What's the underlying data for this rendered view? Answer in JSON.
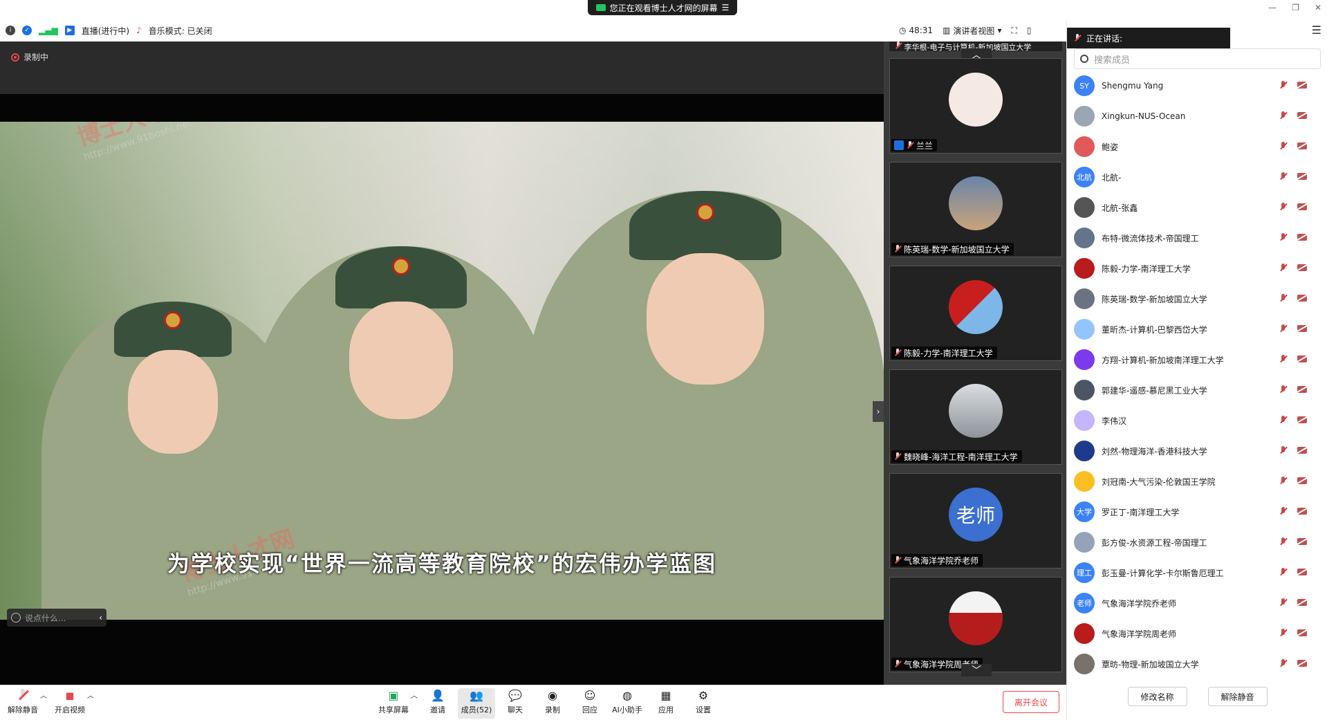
{
  "banner": {
    "text": "您正在观看博士人才网的屏幕"
  },
  "info": {
    "live": "直播(进行中)",
    "music": "音乐模式: 已关闭",
    "timer": "48:31",
    "view": "演讲者视图"
  },
  "stage": {
    "recording": "录制中",
    "subtitle": "为学校实现“世界一流高等教育院校”的宏伟办学蓝图",
    "watermark_cn": "博士人才网",
    "watermark_url": "http://www.91boshi.net",
    "chat_placeholder": "说点什么..."
  },
  "gallery": {
    "top_partial": "李华根-电子与计算机-新加坡国立大学",
    "tiles": [
      {
        "name": "兰兰"
      },
      {
        "name": "陈英瑞-数学-新加坡国立大学"
      },
      {
        "name": "陈毅-力学-南洋理工大学"
      },
      {
        "name": "魏晓峰-海洋工程-南洋理工大学"
      },
      {
        "name": "气象海洋学院乔老师",
        "avatar_text": "老师"
      },
      {
        "name": "气象海洋学院周老师"
      }
    ]
  },
  "panel": {
    "speaking": "正在讲话:",
    "search_placeholder": "搜索成员",
    "members": [
      {
        "name": "Shengmu Yang",
        "avatar": "SY",
        "color": "#3b82f6"
      },
      {
        "name": "Xingkun-NUS-Ocean",
        "avatar": "",
        "color": "#9aa6b2"
      },
      {
        "name": "鲍姿",
        "avatar": "",
        "color": "#e05a5a"
      },
      {
        "name": "北航-",
        "avatar": "北航",
        "color": "#3b82f6"
      },
      {
        "name": "北航-张鑫",
        "avatar": "",
        "color": "#555555"
      },
      {
        "name": "布特-微流体技术-帝国理工",
        "avatar": "",
        "color": "#64748b"
      },
      {
        "name": "陈毅-力学-南洋理工大学",
        "avatar": "",
        "color": "#b91c1c"
      },
      {
        "name": "陈英瑞-数学-新加坡国立大学",
        "avatar": "",
        "color": "#6b7280"
      },
      {
        "name": "董昕杰-计算机-巴黎西岱大学",
        "avatar": "",
        "color": "#93c5fd"
      },
      {
        "name": "方翔-计算机-新加坡南洋理工大学",
        "avatar": "",
        "color": "#7c3aed"
      },
      {
        "name": "郭建华-遥感-慕尼黑工业大学",
        "avatar": "",
        "color": "#4b5563"
      },
      {
        "name": "李伟汉",
        "avatar": "",
        "color": "#c4b5fd"
      },
      {
        "name": "刘然-物理海洋-香港科技大学",
        "avatar": "",
        "color": "#1e3a8a"
      },
      {
        "name": "刘冠南-大气污染-伦敦国王学院",
        "avatar": "",
        "color": "#fbbf24"
      },
      {
        "name": "罗正丁-南洋理工大学",
        "avatar": "大学",
        "color": "#3b82f6"
      },
      {
        "name": "彭方俊-水资源工程-帝国理工",
        "avatar": "",
        "color": "#94a3b8"
      },
      {
        "name": "彭玉曼-计算化学-卡尔斯鲁厄理工",
        "avatar": "理工",
        "color": "#3b82f6"
      },
      {
        "name": "气象海洋学院乔老师",
        "avatar": "老师",
        "color": "#3b82f6"
      },
      {
        "name": "气象海洋学院周老师",
        "avatar": "",
        "color": "#b91c1c"
      },
      {
        "name": "覃昉-物理-新加坡国立大学",
        "avatar": "",
        "color": "#78716c"
      }
    ],
    "rename_btn": "修改名称",
    "unmute_btn": "解除静音"
  },
  "toolbar": {
    "unmute": "解除静音",
    "video": "开启视频",
    "share": "共享屏幕",
    "invite": "邀请",
    "members": "成员(52)",
    "chat": "聊天",
    "record": "录制",
    "react": "回应",
    "ai": "AI小助手",
    "apps": "应用",
    "settings": "设置",
    "leave": "离开会议"
  }
}
